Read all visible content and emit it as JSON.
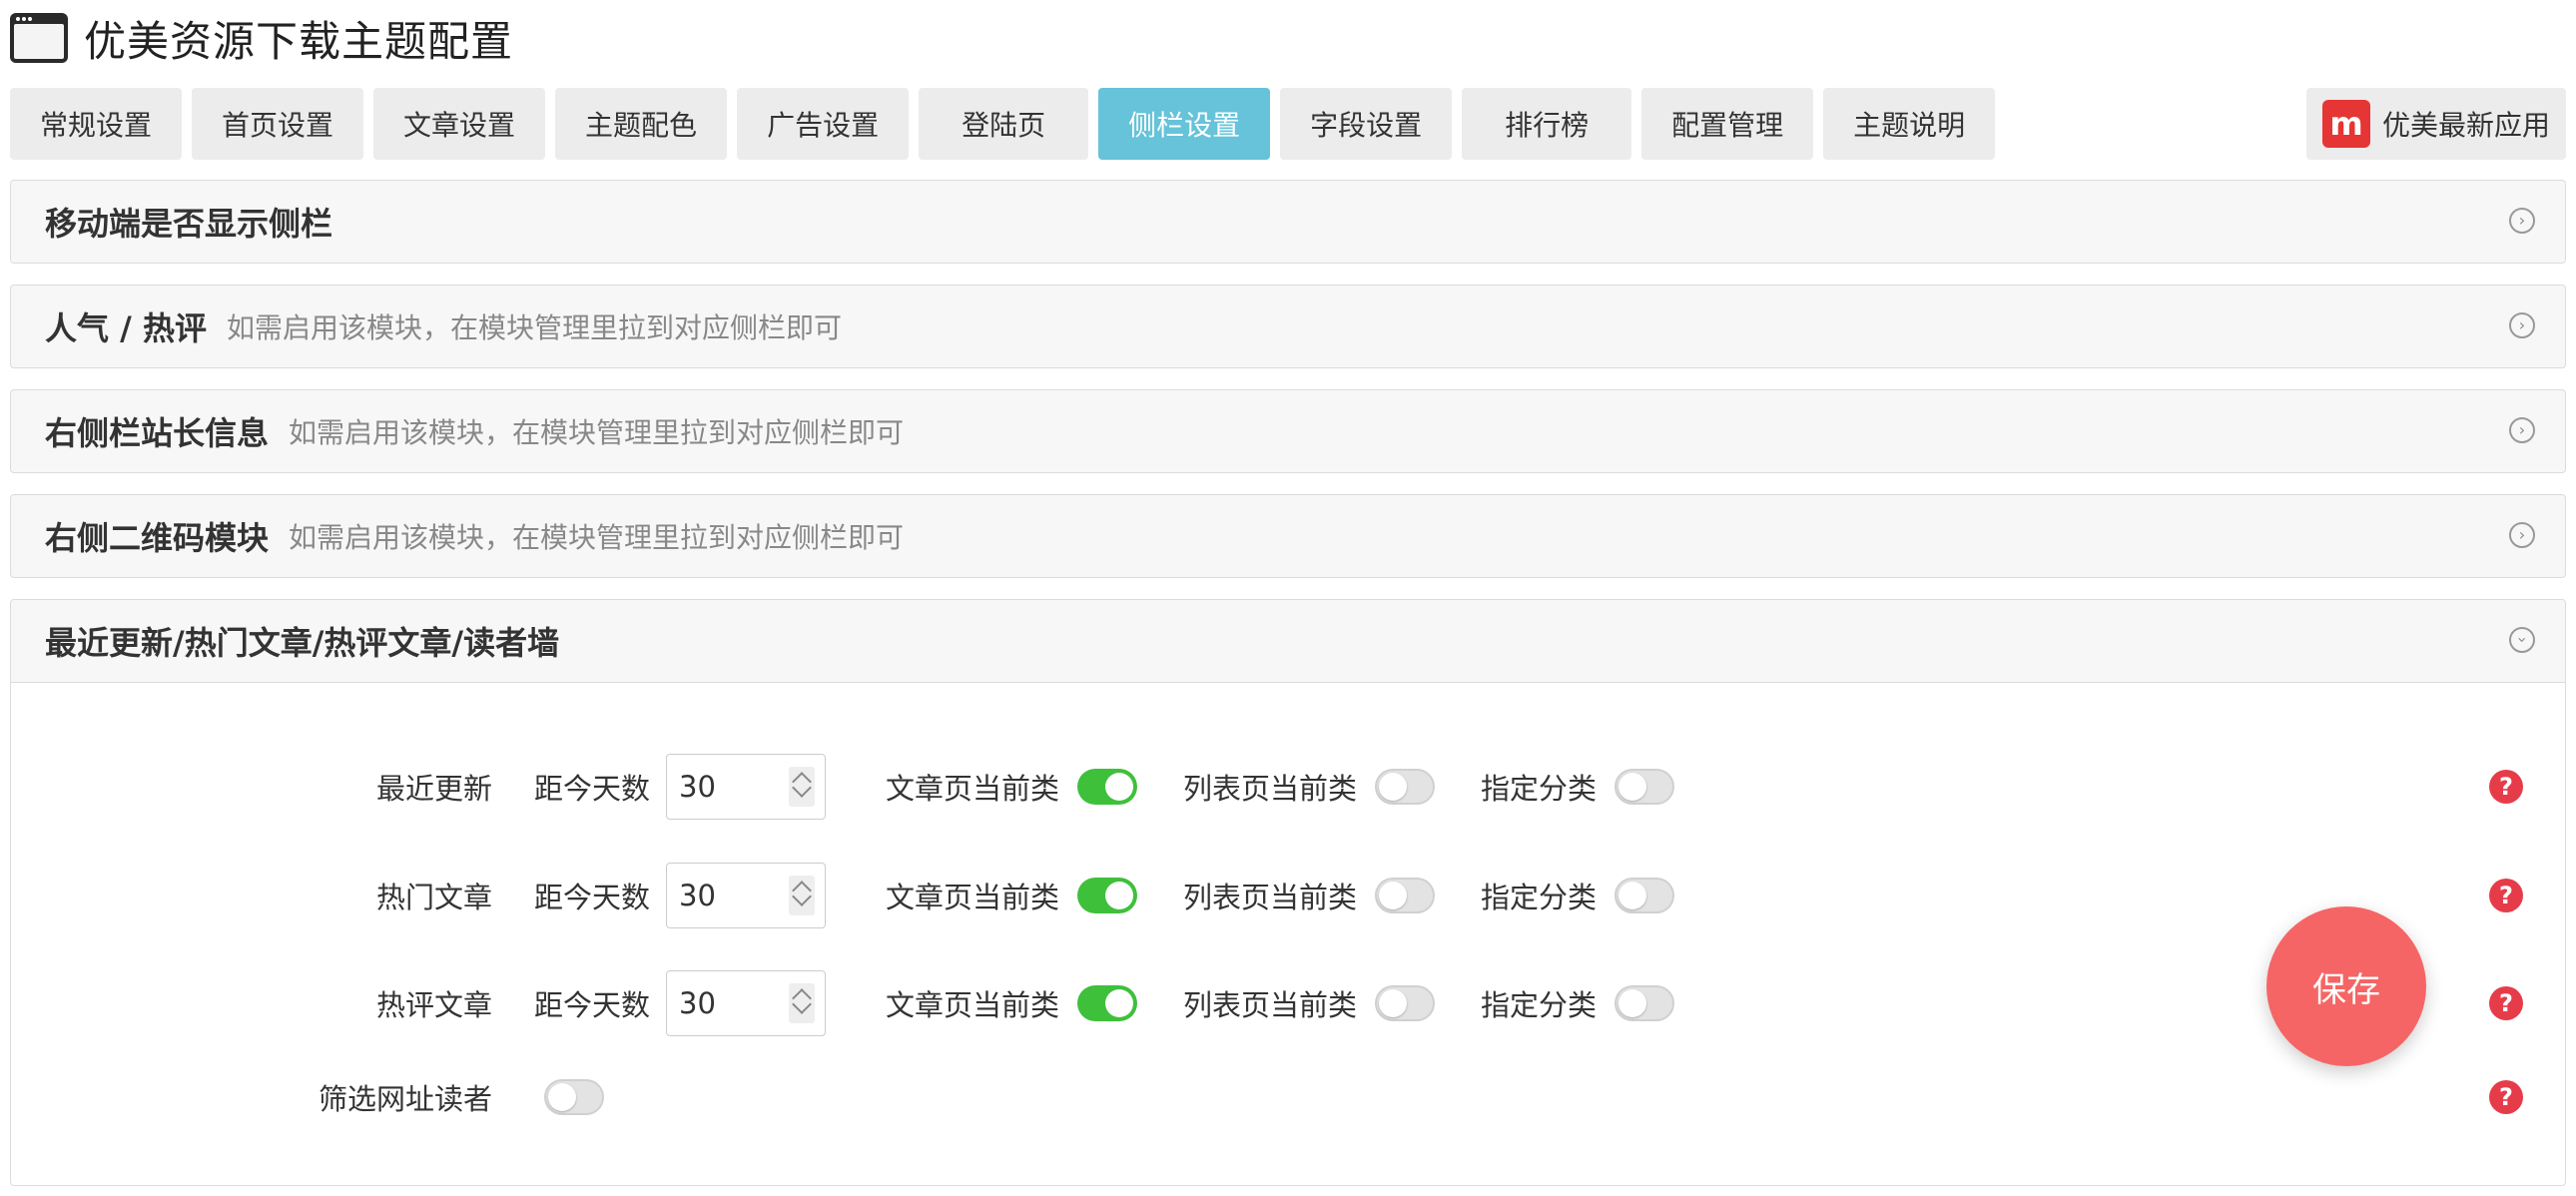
{
  "header": {
    "title": "优美资源下载主题配置"
  },
  "tabs": [
    {
      "label": "常规设置"
    },
    {
      "label": "首页设置"
    },
    {
      "label": "文章设置"
    },
    {
      "label": "主题配色"
    },
    {
      "label": "广告设置"
    },
    {
      "label": "登陆页"
    },
    {
      "label": "侧栏设置"
    },
    {
      "label": "字段设置"
    },
    {
      "label": "排行榜"
    },
    {
      "label": "配置管理"
    },
    {
      "label": "主题说明"
    }
  ],
  "active_tab": "侧栏设置",
  "app_button": {
    "label": "优美最新应用",
    "logo_text": "m"
  },
  "panels": [
    {
      "title": "移动端是否显示侧栏",
      "desc": ""
    },
    {
      "title": "人气 / 热评",
      "desc": "如需启用该模块，在模块管理里拉到对应侧栏即可"
    },
    {
      "title": "右侧栏站长信息",
      "desc": "如需启用该模块，在模块管理里拉到对应侧栏即可"
    },
    {
      "title": "右侧二维码模块",
      "desc": "如需启用该模块，在模块管理里拉到对应侧栏即可"
    },
    {
      "title": "最近更新/热门文章/热评文章/读者墙",
      "desc": ""
    }
  ],
  "rows": [
    {
      "label": "最近更新",
      "days_label": "距今天数",
      "days_value": "30",
      "article_label": "文章页当前类",
      "article_on": true,
      "list_label": "列表页当前类",
      "list_on": false,
      "cat_label": "指定分类",
      "cat_on": false
    },
    {
      "label": "热门文章",
      "days_label": "距今天数",
      "days_value": "30",
      "article_label": "文章页当前类",
      "article_on": true,
      "list_label": "列表页当前类",
      "list_on": false,
      "cat_label": "指定分类",
      "cat_on": false
    },
    {
      "label": "热评文章",
      "days_label": "距今天数",
      "days_value": "30",
      "article_label": "文章页当前类",
      "article_on": true,
      "list_label": "列表页当前类",
      "list_on": false,
      "cat_label": "指定分类",
      "cat_on": false
    }
  ],
  "filter_row": {
    "label": "筛选网址读者",
    "on": false
  },
  "help_icon": "?",
  "save_button": {
    "label": "保存"
  },
  "colors": {
    "active_tab": "#66c3d9",
    "switch_on": "#3fc03b",
    "save": "#f66565",
    "help": "#e63c4a"
  }
}
